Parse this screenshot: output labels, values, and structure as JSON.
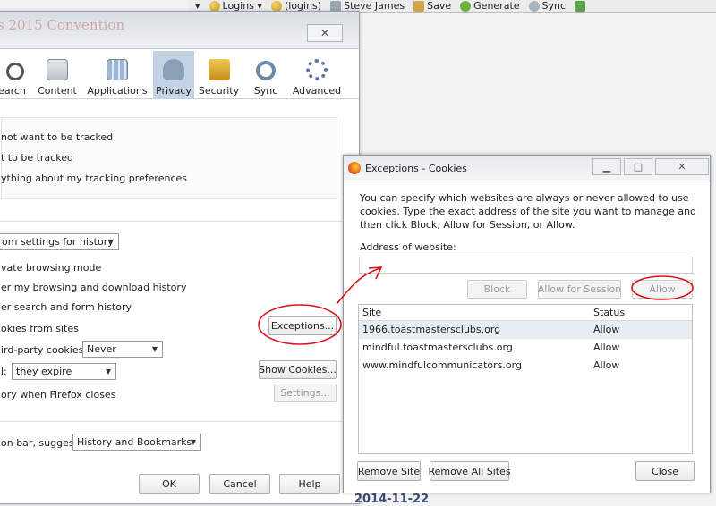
{
  "toolbar": {
    "items": [
      {
        "label": "Logins ▾",
        "icon": "key-icon"
      },
      {
        "label": "(logins)",
        "icon": "key-icon"
      },
      {
        "label": "Steve James",
        "icon": "person-icon"
      },
      {
        "label": "Save",
        "icon": "save-icon"
      },
      {
        "label": "Generate",
        "icon": "generate-icon"
      },
      {
        "label": "Sync",
        "icon": "sync-icon"
      }
    ]
  },
  "options": {
    "title_fragment": "s 2015 Convention",
    "tabs": [
      {
        "label": "Search"
      },
      {
        "label": "Content"
      },
      {
        "label": "Applications"
      },
      {
        "label": "Privacy",
        "selected": true
      },
      {
        "label": "Security"
      },
      {
        "label": "Sync"
      },
      {
        "label": "Advanced"
      }
    ],
    "tracking": [
      "not want to be tracked",
      "t to be tracked",
      "ything about my tracking preferences"
    ],
    "history_select": "om settings for history",
    "history_rows": [
      "vate browsing mode",
      "er my browsing and download history",
      "er search and form history",
      "okies from sites"
    ],
    "third_party_label": "ird-party cookies:",
    "third_party_value": "Never",
    "keep_label": "l:",
    "keep_value": "they expire",
    "clear_row": "ory when Firefox closes",
    "exceptions_button": "Exceptions...",
    "show_cookies_button": "Show Cookies...",
    "settings_button": "Settings...",
    "locationbar_label": "on bar, suggest:",
    "locationbar_value": "History and Bookmarks",
    "ok": "OK",
    "cancel": "Cancel",
    "help": "Help"
  },
  "exceptions": {
    "title": "Exceptions - Cookies",
    "description": "You can specify which websites are always or never allowed to use cookies. Type the exact address of the site you want to manage and then click Block, Allow for Session, or Allow.",
    "address_label": "Address of website:",
    "address_value": "",
    "block": "Block",
    "allow_session": "Allow for Session",
    "allow": "Allow",
    "columns": [
      "Site",
      "Status"
    ],
    "rows": [
      {
        "site": "1966.toastmastersclubs.org",
        "status": "Allow"
      },
      {
        "site": "mindful.toastmastersclubs.org",
        "status": "Allow"
      },
      {
        "site": "www.mindfulcommunicators.org",
        "status": "Allow"
      }
    ],
    "remove_site": "Remove Site",
    "remove_all": "Remove All Sites",
    "close": "Close"
  },
  "background_text": "2014-11-22",
  "annotation_color": "#d9131b"
}
